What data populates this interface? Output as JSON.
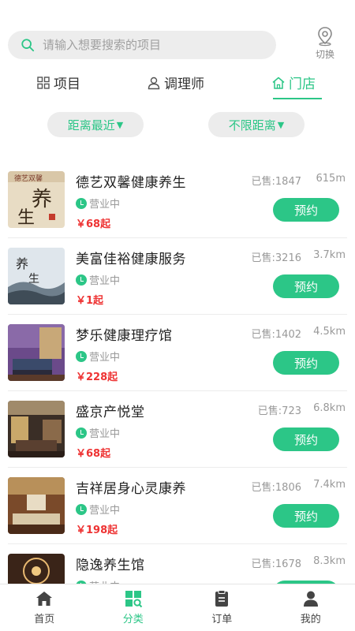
{
  "search": {
    "placeholder": "请输入想要搜索的项目"
  },
  "location": {
    "label": "切换"
  },
  "tabs": [
    {
      "label": "项目",
      "icon": "grid-icon"
    },
    {
      "label": "调理师",
      "icon": "user-icon"
    },
    {
      "label": "门店",
      "icon": "home-icon",
      "active": true
    }
  ],
  "filters": [
    {
      "label": "距离最近",
      "arrow": "▼"
    },
    {
      "label": "不限距离",
      "arrow": "▼"
    }
  ],
  "stores": [
    {
      "name": "德艺双馨健康养生",
      "status": "营业中",
      "price": "￥68起",
      "sold": "已售:1847",
      "distance": "615m",
      "button": "预约"
    },
    {
      "name": "美富佳裕健康服务",
      "status": "营业中",
      "price": "￥1起",
      "sold": "已售:3216",
      "distance": "3.7km",
      "button": "预约"
    },
    {
      "name": "梦乐健康理疗馆",
      "status": "营业中",
      "price": "￥228起",
      "sold": "已售:1402",
      "distance": "4.5km",
      "button": "预约"
    },
    {
      "name": "盛京产悦堂",
      "status": "营业中",
      "price": "￥68起",
      "sold": "已售:723",
      "distance": "6.8km",
      "button": "预约"
    },
    {
      "name": "吉祥居身心灵康养",
      "status": "营业中",
      "price": "￥198起",
      "sold": "已售:1806",
      "distance": "7.4km",
      "button": "预约"
    },
    {
      "name": "隐逸养生馆",
      "status": "营业中",
      "price": "",
      "sold": "已售:1678",
      "distance": "8.3km",
      "button": "预约"
    }
  ],
  "nav": [
    {
      "label": "首页",
      "icon": "home-icon"
    },
    {
      "label": "分类",
      "icon": "category-icon",
      "active": true
    },
    {
      "label": "订单",
      "icon": "order-icon"
    },
    {
      "label": "我的",
      "icon": "profile-icon"
    }
  ],
  "colors": {
    "accent": "#2cc687",
    "price": "#e33333"
  }
}
